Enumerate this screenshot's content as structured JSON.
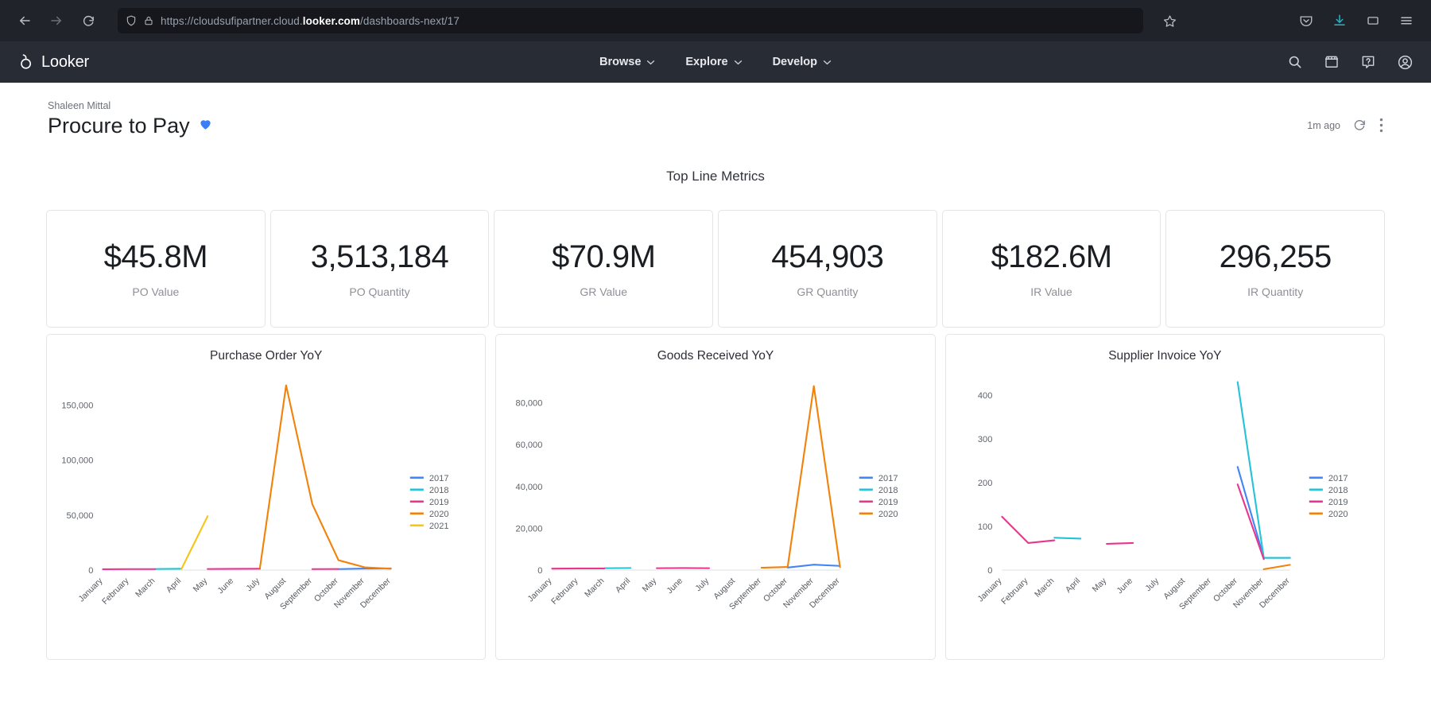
{
  "browser": {
    "url_prefix": "https://cloudsufipartner.cloud.",
    "url_domain": "looker.com",
    "url_path": "/dashboards-next/17",
    "icons": {
      "back": "back-arrow-icon",
      "forward": "forward-arrow-icon",
      "reload": "reload-icon",
      "shield": "shield-icon",
      "lock": "lock-icon",
      "bookmark": "star-icon",
      "pocket": "pocket-icon",
      "downloads": "download-icon",
      "container": "container-tab-icon",
      "menu": "hamburger-menu-icon"
    },
    "colors": {
      "chrome_bg": "#20232a",
      "urlbar_bg": "#15171c",
      "download_accent": "#26b5c9"
    }
  },
  "looker_nav": {
    "brand": "Looker",
    "items": [
      {
        "label": "Browse",
        "has_caret": true
      },
      {
        "label": "Explore",
        "has_caret": true
      },
      {
        "label": "Develop",
        "has_caret": true
      }
    ],
    "right_icons": [
      "search-icon",
      "marketplace-icon",
      "help-icon",
      "account-avatar-icon"
    ],
    "bg": "#272c35"
  },
  "dashboard": {
    "breadcrumb": "Shaleen Mittal",
    "title": "Procure to Pay",
    "favorite_icon": "heart-icon",
    "favorite_color": "#3b7ef5",
    "last_run": "1m ago",
    "refresh_icon": "refresh-icon",
    "menu_icon": "vertical-dots-icon",
    "section_title": "Top Line Metrics"
  },
  "kpis": [
    {
      "value": "$45.8M",
      "label": "PO Value"
    },
    {
      "value": "3,513,184",
      "label": "PO Quantity"
    },
    {
      "value": "$70.9M",
      "label": "GR Value"
    },
    {
      "value": "454,903",
      "label": "GR Quantity"
    },
    {
      "value": "$182.6M",
      "label": "IR Value"
    },
    {
      "value": "296,255",
      "label": "IR Quantity"
    }
  ],
  "series_colors": {
    "2017": "#4285f4",
    "2018": "#25c3d6",
    "2019": "#e8368f",
    "2020": "#f2820a",
    "2021": "#f5c518"
  },
  "chart_data": [
    {
      "type": "line",
      "title": "Purchase Order YoY",
      "xlabel": "",
      "ylabel": "",
      "grid": false,
      "legend_position": "right",
      "categories": [
        "January",
        "February",
        "March",
        "April",
        "May",
        "June",
        "July",
        "August",
        "September",
        "October",
        "November",
        "December"
      ],
      "yticks": [
        0,
        50000,
        100000,
        150000
      ],
      "ylim": [
        0,
        175000
      ],
      "series": [
        {
          "name": "2017",
          "color": "#4285f4",
          "values": [
            null,
            null,
            null,
            null,
            null,
            null,
            null,
            null,
            null,
            900,
            1400,
            1500
          ]
        },
        {
          "name": "2018",
          "color": "#25c3d6",
          "values": [
            null,
            null,
            1000,
            1200,
            null,
            null,
            null,
            null,
            null,
            null,
            null,
            null
          ]
        },
        {
          "name": "2019",
          "color": "#e8368f",
          "values": [
            800,
            900,
            900,
            null,
            1000,
            1100,
            1200,
            null,
            900,
            1000,
            null,
            null
          ]
        },
        {
          "name": "2020",
          "color": "#f2820a",
          "values": [
            null,
            null,
            null,
            null,
            null,
            null,
            2000,
            168000,
            60000,
            9000,
            2500,
            1200
          ]
        },
        {
          "name": "2021",
          "color": "#f5c518",
          "values": [
            null,
            null,
            null,
            1000,
            49000,
            null,
            null,
            null,
            null,
            null,
            null,
            null
          ]
        }
      ]
    },
    {
      "type": "line",
      "title": "Goods Received YoY",
      "xlabel": "",
      "ylabel": "",
      "grid": false,
      "legend_position": "right",
      "categories": [
        "January",
        "February",
        "March",
        "April",
        "May",
        "June",
        "July",
        "August",
        "September",
        "October",
        "November",
        "December"
      ],
      "yticks": [
        0,
        20000,
        40000,
        60000,
        80000
      ],
      "ylim": [
        0,
        92000
      ],
      "series": [
        {
          "name": "2017",
          "color": "#4285f4",
          "values": [
            null,
            null,
            null,
            null,
            null,
            null,
            null,
            null,
            null,
            1200,
            2600,
            2000
          ]
        },
        {
          "name": "2018",
          "color": "#25c3d6",
          "values": [
            null,
            null,
            900,
            1000,
            null,
            null,
            null,
            null,
            null,
            null,
            null,
            null
          ]
        },
        {
          "name": "2019",
          "color": "#e8368f",
          "values": [
            700,
            800,
            800,
            null,
            900,
            1000,
            900,
            null,
            null,
            null,
            null,
            null
          ]
        },
        {
          "name": "2020",
          "color": "#f2820a",
          "values": [
            null,
            null,
            null,
            null,
            null,
            null,
            null,
            null,
            1100,
            1500,
            88000,
            1400
          ]
        }
      ]
    },
    {
      "type": "line",
      "title": "Supplier Invoice YoY",
      "xlabel": "",
      "ylabel": "",
      "grid": false,
      "legend_position": "right",
      "categories": [
        "January",
        "February",
        "March",
        "April",
        "May",
        "June",
        "July",
        "August",
        "September",
        "October",
        "November",
        "December"
      ],
      "yticks": [
        0,
        100,
        200,
        300,
        400
      ],
      "ylim": [
        0,
        440
      ],
      "series": [
        {
          "name": "2017",
          "color": "#4285f4",
          "values": [
            null,
            null,
            null,
            null,
            null,
            null,
            null,
            null,
            null,
            236,
            28,
            28
          ]
        },
        {
          "name": "2018",
          "color": "#25c3d6",
          "values": [
            null,
            null,
            74,
            72,
            null,
            null,
            null,
            null,
            null,
            430,
            28,
            28
          ]
        },
        {
          "name": "2019",
          "color": "#e8368f",
          "values": [
            122,
            62,
            68,
            null,
            60,
            62,
            null,
            null,
            null,
            196,
            25,
            null
          ]
        },
        {
          "name": "2020",
          "color": "#f2820a",
          "values": [
            null,
            null,
            null,
            null,
            null,
            null,
            null,
            null,
            null,
            null,
            2,
            12
          ]
        }
      ]
    }
  ]
}
